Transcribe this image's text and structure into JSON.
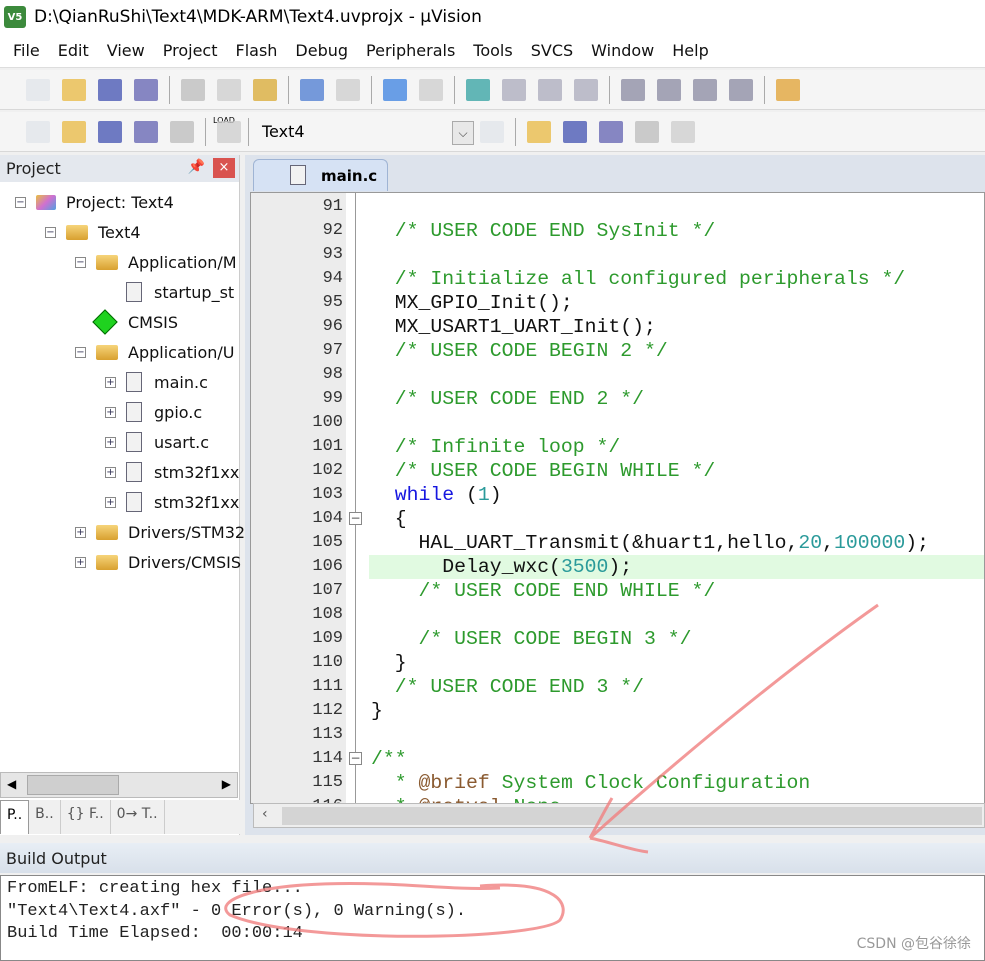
{
  "window": {
    "title": "D:\\QianRuShi\\Text4\\MDK-ARM\\Text4.uvprojx - µVision",
    "logo": "V5"
  },
  "menu": [
    "File",
    "Edit",
    "View",
    "Project",
    "Flash",
    "Debug",
    "Peripherals",
    "Tools",
    "SVCS",
    "Window",
    "Help"
  ],
  "toolbar1": [
    "new-file-icon",
    "open-folder-icon",
    "save-icon",
    "save-all-icon",
    "|",
    "cut-icon",
    "copy-icon",
    "paste-icon",
    "|",
    "undo-icon",
    "redo-icon",
    "|",
    "back-arrow-icon",
    "forward-arrow-icon",
    "|",
    "bookmark-icon",
    "prev-bookmark-icon",
    "next-bookmark-icon",
    "clear-bookmark-icon",
    "|",
    "indent-icon",
    "unindent-icon",
    "comment-icon",
    "uncomment-icon",
    "|",
    "find-in-files-icon"
  ],
  "toolbar2": {
    "icons_left": [
      "translate-icon",
      "build-icon",
      "rebuild-icon",
      "batch-build-icon",
      "stop-build-icon",
      "|",
      "load-icon"
    ],
    "load_label": "LOAD",
    "target": "Text4",
    "icons_right": [
      "target-options-icon",
      "|",
      "manage-components-icon",
      "file-extensions-icon",
      "pack-installer-icon",
      "select-packs-icon",
      "event-recorder-icon"
    ]
  },
  "project_panel": {
    "title": "Project",
    "tree": [
      {
        "label": "Project: Text4",
        "level": 0,
        "expander": "−",
        "icon": "project"
      },
      {
        "label": "Text4",
        "level": 1,
        "expander": "−",
        "icon": "folder"
      },
      {
        "label": "Application/M",
        "level": 2,
        "expander": "−",
        "icon": "folder"
      },
      {
        "label": "startup_st",
        "level": 3,
        "expander": "",
        "icon": "file"
      },
      {
        "label": "CMSIS",
        "level": 2,
        "expander": "",
        "icon": "cmsis"
      },
      {
        "label": "Application/U",
        "level": 2,
        "expander": "−",
        "icon": "folder"
      },
      {
        "label": "main.c",
        "level": 3,
        "expander": "+",
        "icon": "file"
      },
      {
        "label": "gpio.c",
        "level": 3,
        "expander": "+",
        "icon": "file"
      },
      {
        "label": "usart.c",
        "level": 3,
        "expander": "+",
        "icon": "file"
      },
      {
        "label": "stm32f1xx",
        "level": 3,
        "expander": "+",
        "icon": "file"
      },
      {
        "label": "stm32f1xx",
        "level": 3,
        "expander": "+",
        "icon": "file"
      },
      {
        "label": "Drivers/STM32",
        "level": 2,
        "expander": "+",
        "icon": "folder"
      },
      {
        "label": "Drivers/CMSIS",
        "level": 2,
        "expander": "+",
        "icon": "folder"
      }
    ],
    "tabs": [
      "P..",
      "B..",
      "{} F..",
      "0→ T.."
    ]
  },
  "editor": {
    "tab": "main.c",
    "highlight_line": 106,
    "lines": [
      {
        "n": "91",
        "s": []
      },
      {
        "n": "92",
        "s": [
          [
            "com",
            "  /* USER CODE END SysInit */"
          ]
        ]
      },
      {
        "n": "93",
        "s": []
      },
      {
        "n": "94",
        "s": [
          [
            "com",
            "  /* Initialize all configured peripherals */"
          ]
        ]
      },
      {
        "n": "95",
        "s": [
          [
            "",
            "  MX_GPIO_Init();"
          ]
        ]
      },
      {
        "n": "96",
        "s": [
          [
            "",
            "  MX_USART1_UART_Init();"
          ]
        ]
      },
      {
        "n": "97",
        "s": [
          [
            "com",
            "  /* USER CODE BEGIN 2 */"
          ]
        ]
      },
      {
        "n": "98",
        "s": []
      },
      {
        "n": "99",
        "s": [
          [
            "com",
            "  /* USER CODE END 2 */"
          ]
        ]
      },
      {
        "n": "100",
        "s": []
      },
      {
        "n": "101",
        "s": [
          [
            "com",
            "  /* Infinite loop */"
          ]
        ]
      },
      {
        "n": "102",
        "s": [
          [
            "com",
            "  /* USER CODE BEGIN WHILE */"
          ]
        ]
      },
      {
        "n": "103",
        "s": [
          [
            "",
            "  "
          ],
          [
            "kw",
            "while"
          ],
          [
            "",
            " ("
          ],
          [
            "num",
            "1"
          ],
          [
            "",
            ")"
          ]
        ]
      },
      {
        "n": "104",
        "s": [
          [
            "",
            "  {"
          ]
        ],
        "fold": "−"
      },
      {
        "n": "105",
        "s": [
          [
            "",
            "    HAL_UART_Transmit(&huart1,hello,"
          ],
          [
            "num",
            "20"
          ],
          [
            "",
            ","
          ],
          [
            "num",
            "100000"
          ],
          [
            "",
            ");"
          ]
        ]
      },
      {
        "n": "106",
        "s": [
          [
            "",
            "      Delay_wxc("
          ],
          [
            "num",
            "3500"
          ],
          [
            "",
            ");"
          ]
        ]
      },
      {
        "n": "107",
        "s": [
          [
            "com",
            "    /* USER CODE END WHILE */"
          ]
        ]
      },
      {
        "n": "108",
        "s": []
      },
      {
        "n": "109",
        "s": [
          [
            "com",
            "    /* USER CODE BEGIN 3 */"
          ]
        ]
      },
      {
        "n": "110",
        "s": [
          [
            "",
            "  }"
          ]
        ]
      },
      {
        "n": "111",
        "s": [
          [
            "com",
            "  /* USER CODE END 3 */"
          ]
        ]
      },
      {
        "n": "112",
        "s": [
          [
            "",
            "}"
          ]
        ]
      },
      {
        "n": "113",
        "s": []
      },
      {
        "n": "114",
        "s": [
          [
            "com",
            "/**"
          ]
        ],
        "fold": "−"
      },
      {
        "n": "115",
        "s": [
          [
            "com",
            "  * "
          ],
          [
            "tag",
            "@brief"
          ],
          [
            "com",
            " System Clock Configuration"
          ]
        ]
      },
      {
        "n": "116",
        "s": [
          [
            "com",
            "  * "
          ],
          [
            "tag",
            "@retval"
          ],
          [
            "com",
            " None"
          ]
        ]
      }
    ]
  },
  "build_output": {
    "title": "Build Output",
    "lines": [
      "FromELF: creating hex file...",
      "\"Text4\\Text4.axf\" - 0 Error(s), 0 Warning(s).",
      "Build Time Elapsed:  00:00:14"
    ]
  },
  "watermark": "CSDN @包谷徐徐",
  "colors": {
    "comment": "#2d9a2d",
    "keyword": "#1717e0",
    "number": "#2a9a9a",
    "highlight": "#e1fae1",
    "annotation": "#f08080"
  }
}
